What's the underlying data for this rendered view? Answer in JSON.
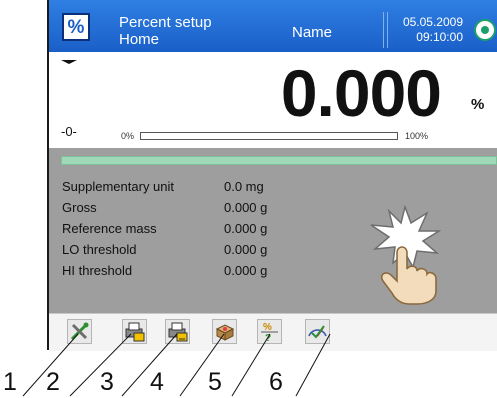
{
  "header": {
    "mode_icon_label": "%",
    "mode_title": "Percent setup",
    "mode_subtitle": "Home",
    "name": "Name",
    "date": "05.05.2009",
    "time": "09:10:00",
    "status_icon": "target-icon"
  },
  "weighing": {
    "stable_indicator": "stability-marker-icon",
    "zero_indicator": "-0-",
    "reading": "0.000",
    "unit": "%",
    "bargraph_min": "0%",
    "bargraph_max": "100%",
    "bargraph_fill_percent": 0
  },
  "info": {
    "rows": [
      {
        "label": "Supplementary unit",
        "value": "0.0 mg"
      },
      {
        "label": "Gross",
        "value": "0.000 g"
      },
      {
        "label": "Reference mass",
        "value": "0.000 g"
      },
      {
        "label": "LO threshold",
        "value": "0.000 g"
      },
      {
        "label": "HI threshold",
        "value": "0.000 g"
      }
    ]
  },
  "toolbar": {
    "keys": [
      {
        "icon": "tools-icon"
      },
      {
        "icon": "printer-header-icon"
      },
      {
        "icon": "printer-footer-icon"
      },
      {
        "icon": "tare-box-icon"
      },
      {
        "icon": "percent-setup-icon"
      },
      {
        "icon": "adjustment-gauge-icon"
      }
    ]
  },
  "callouts": [
    "1",
    "2",
    "3",
    "4",
    "5",
    "6"
  ],
  "colors": {
    "header_blue": "#1a5fc8",
    "panel_grey": "#9e9e9e",
    "stripe_green": "#9fd9b7"
  }
}
